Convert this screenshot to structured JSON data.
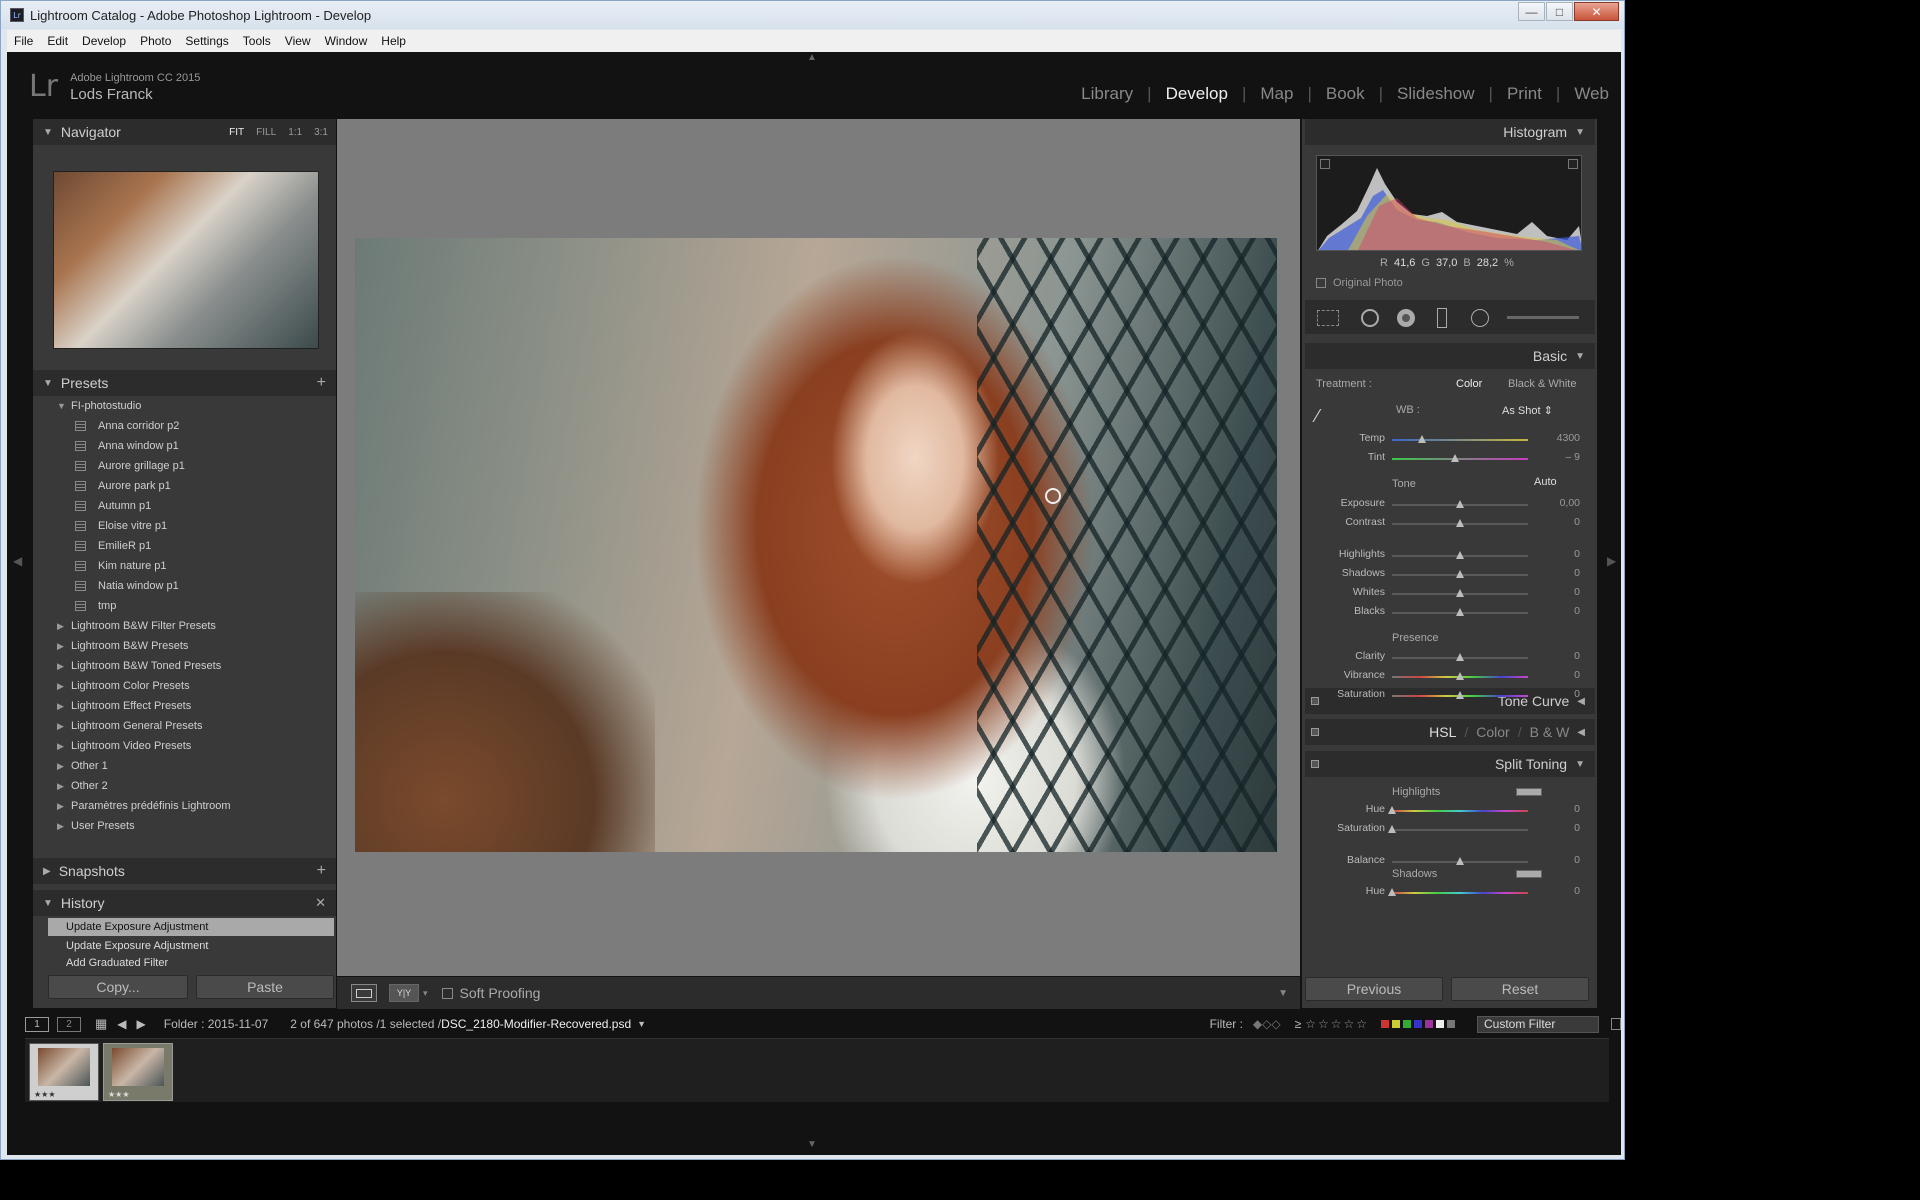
{
  "window": {
    "title": "Lightroom Catalog - Adobe Photoshop Lightroom - Develop",
    "min": "—",
    "max": "□",
    "close": "✕"
  },
  "menu": [
    "File",
    "Edit",
    "Develop",
    "Photo",
    "Settings",
    "Tools",
    "View",
    "Window",
    "Help"
  ],
  "identity": {
    "logo": "Lr",
    "product": "Adobe Lightroom CC 2015",
    "user": "Lods Franck"
  },
  "modules": [
    "Library",
    "Develop",
    "Map",
    "Book",
    "Slideshow",
    "Print",
    "Web"
  ],
  "active_module": "Develop",
  "navigator": {
    "title": "Navigator",
    "options": [
      "FIT",
      "FILL",
      "1:1",
      "3:1"
    ]
  },
  "presets": {
    "title": "Presets",
    "folder": "FI-photostudio",
    "items": [
      "Anna corridor p2",
      "Anna window p1",
      "Aurore grillage p1",
      "Aurore park p1",
      "Autumn p1",
      "Eloise vitre p1",
      "EmilieR p1",
      "Kim nature p1",
      "Natia window p1",
      "tmp"
    ],
    "groups": [
      "Lightroom B&W Filter Presets",
      "Lightroom B&W Presets",
      "Lightroom B&W Toned Presets",
      "Lightroom Color Presets",
      "Lightroom Effect Presets",
      "Lightroom General Presets",
      "Lightroom Video Presets",
      "Other 1",
      "Other 2",
      "Paramètres prédéfinis Lightroom",
      "User Presets"
    ]
  },
  "snapshots": {
    "title": "Snapshots"
  },
  "history": {
    "title": "History",
    "items": [
      "Update Exposure Adjustment",
      "Update Exposure Adjustment",
      "Add Graduated Filter"
    ]
  },
  "left_buttons": {
    "copy": "Copy...",
    "paste": "Paste"
  },
  "toolbar": {
    "soft_proofing": "Soft Proofing",
    "yy": "Y|Y"
  },
  "right": {
    "histogram_title": "Histogram",
    "rgb": {
      "r_label": "R",
      "r": "41,6",
      "g_label": "G",
      "g": "37,0",
      "b_label": "B",
      "b": "28,2",
      "unit": "%"
    },
    "original_photo": "Original Photo",
    "basic_title": "Basic",
    "treatment_label": "Treatment :",
    "treatment_color": "Color",
    "treatment_bw": "Black & White",
    "wb_label": "WB :",
    "wb_value": "As Shot ⇕",
    "temp": {
      "label": "Temp",
      "value": "4300",
      "pos": 0.22
    },
    "tint": {
      "label": "Tint",
      "value": "– 9",
      "pos": 0.46
    },
    "tone_label": "Tone",
    "auto": "Auto",
    "tone": [
      {
        "label": "Exposure",
        "value": "0,00",
        "pos": 0.5
      },
      {
        "label": "Contrast",
        "value": "0",
        "pos": 0.5
      },
      {
        "label": "Highlights",
        "value": "0",
        "pos": 0.5
      },
      {
        "label": "Shadows",
        "value": "0",
        "pos": 0.5
      },
      {
        "label": "Whites",
        "value": "0",
        "pos": 0.5
      },
      {
        "label": "Blacks",
        "value": "0",
        "pos": 0.5
      }
    ],
    "presence_label": "Presence",
    "presence": [
      {
        "label": "Clarity",
        "value": "0",
        "pos": 0.5
      },
      {
        "label": "Vibrance",
        "value": "0",
        "pos": 0.5
      },
      {
        "label": "Saturation",
        "value": "0",
        "pos": 0.5
      }
    ],
    "tone_curve": "Tone Curve",
    "hsl": "HSL",
    "hsl_color": "Color",
    "hsl_bw": "B & W",
    "slash": "/",
    "split_toning": "Split Toning",
    "st_highlights": "Highlights",
    "st_hue": {
      "label": "Hue",
      "value": "0",
      "pos": 0.0
    },
    "st_sat": {
      "label": "Saturation",
      "value": "0",
      "pos": 0.0
    },
    "st_balance": {
      "label": "Balance",
      "value": "0",
      "pos": 0.5
    },
    "st_shadows": "Shadows",
    "st_hue2": {
      "label": "Hue",
      "value": "0",
      "pos": 0.0
    },
    "previous": "Previous",
    "reset": "Reset"
  },
  "filmstrip": {
    "view1": "1",
    "view2": "2",
    "folder": "Folder : 2015-11-07",
    "count": "2 of 647 photos /1 selected /",
    "filename": "DSC_2180-Modifier-Recovered.psd",
    "filter_label": "Filter :",
    "gte": "≥",
    "custom_filter": "Custom Filter",
    "thumb_stars": "★★★"
  }
}
